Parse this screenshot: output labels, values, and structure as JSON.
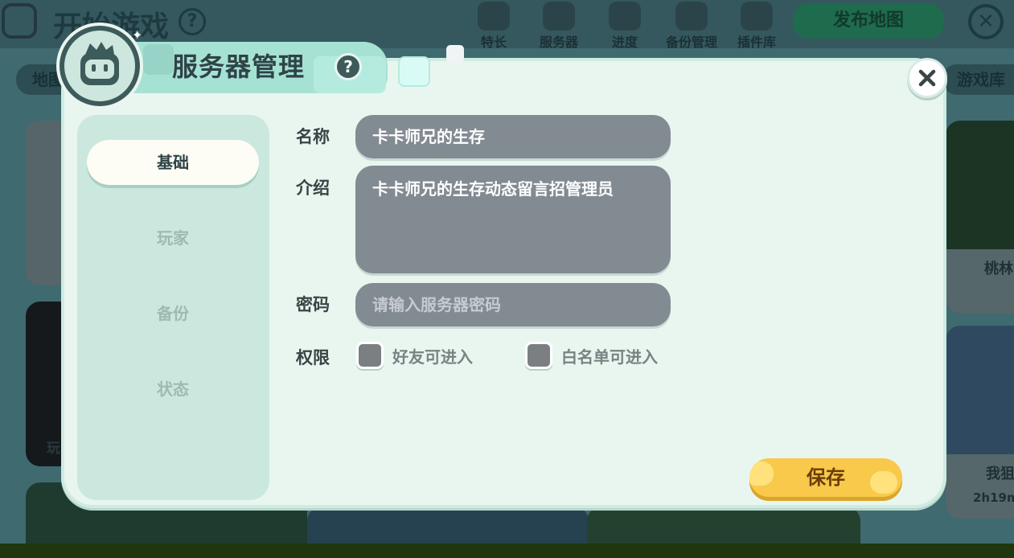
{
  "background": {
    "title": "开始游戏",
    "help": "?",
    "nav": [
      {
        "label": "特长"
      },
      {
        "label": "服务器"
      },
      {
        "label": "进度"
      },
      {
        "label": "备份管理"
      },
      {
        "label": "插件库"
      }
    ],
    "publish_label": "发布地图",
    "close": "✕",
    "left_tab": "地图",
    "right_tab": "游戏库",
    "card_left_label": "玩",
    "card_right1_label": "桃林",
    "card_right2_label": "我狙",
    "card_right2_time": "2h19m"
  },
  "modal": {
    "title": "服务器管理",
    "help": "?",
    "sidebar": {
      "tabs": [
        {
          "label": "基础",
          "active": true
        },
        {
          "label": "玩家",
          "active": false
        },
        {
          "label": "备份",
          "active": false
        },
        {
          "label": "状态",
          "active": false
        }
      ]
    },
    "form": {
      "name_label": "名称",
      "name_value": "卡卡师兄的生存",
      "intro_label": "介绍",
      "intro_value": "卡卡师兄的生存动态留言招管理员",
      "password_label": "密码",
      "password_placeholder": "请输入服务器密码",
      "permission_label": "权限",
      "permission_options": [
        {
          "label": "好友可进入",
          "checked": false
        },
        {
          "label": "白名单可进入",
          "checked": false
        }
      ]
    },
    "save_label": "保存"
  },
  "colors": {
    "modal_bg": "#e9f6ef",
    "sidebar_bg": "#cbe8de",
    "field_bg": "#828a92",
    "save_bg": "#f8c94a",
    "accent_teal": "#a6e2d3"
  }
}
